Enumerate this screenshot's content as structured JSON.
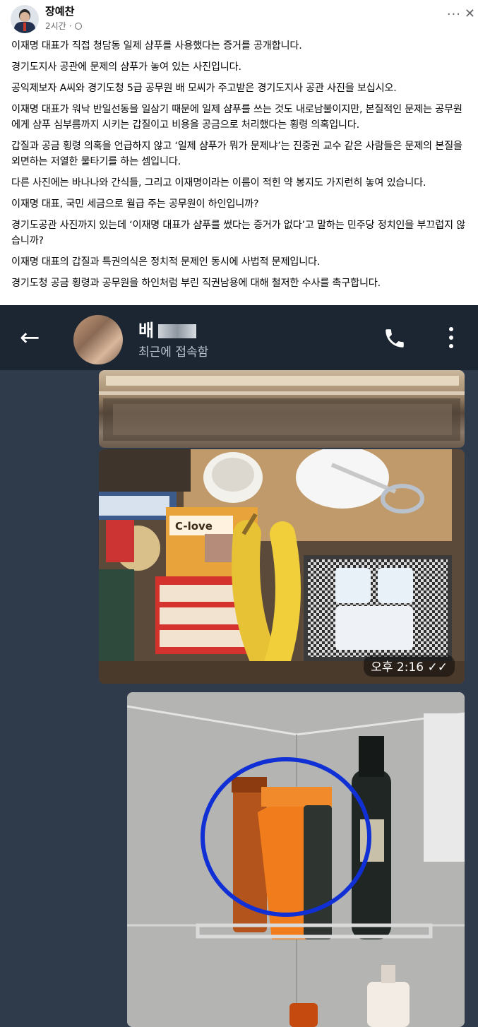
{
  "post": {
    "author": "장예찬",
    "time": "2시간",
    "more_label": "···",
    "close_label": "✕",
    "paragraphs": [
      "이재명 대표가 직접 청담동 일제 샴푸를 사용했다는 증거를 공개합니다.",
      "경기도지사 공관에 문제의 샴푸가 놓여 있는 사진입니다.",
      "공익제보자 A씨와 경기도청 5급 공무원 배 모씨가 주고받은 경기도지사 공관 사진을 보십시오.",
      "이재명 대표가 워낙 반일선동을 일삼기 때문에 일제 샴푸를 쓰는 것도 내로남불이지만, 본질적인 문제는 공무원에게 샴푸 심부름까지 시키는 갑질이고 비용을 공금으로 처리했다는 횡령 의혹입니다.",
      "갑질과 공금 횡령 의혹을 언급하지 않고 ‘일제 샴푸가 뭐가 문제냐’는 진중권 교수 같은 사람들은 문제의 본질을 외면하는 저열한 물타기를 하는 셈입니다.",
      "다른 사진에는 바나나와 간식들, 그리고 이재명이라는 이름이 적힌 약 봉지도 가지런히 놓여 있습니다.",
      "이재명 대표, 국민 세금으로 월급 주는 공무원이 하인입니까?",
      "경기도공관 사진까지 있는데 ‘이재명 대표가 샴푸를 썼다는 증거가 없다’고 말하는 민주당 정치인을 부끄럽지 않습니까?",
      "이재명 대표의 갑질과 특권의식은 정치적 문제인 동시에 사법적 문제입니다.",
      "경기도청 공금 횡령과 공무원을 하인처럼 부린 직권남용에 대해 철저한 수사를 촉구합니다."
    ]
  },
  "chat": {
    "contact_name": "배",
    "status": "최근에 접속함",
    "back_icon": "arrow-left-icon",
    "call_icon": "phone-icon",
    "menu_icon": "more-vertical-icon",
    "message_time": "오후 2:16",
    "snack_label": "C-love"
  }
}
